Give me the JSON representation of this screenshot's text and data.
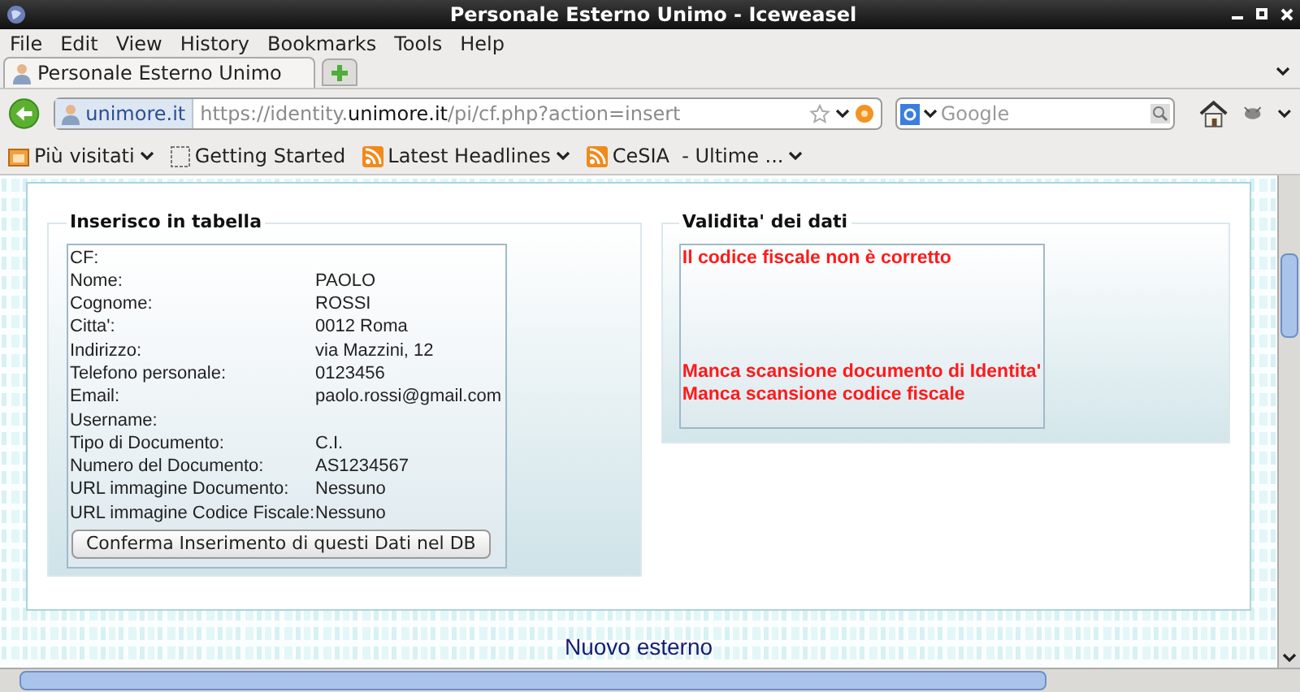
{
  "window": {
    "title": "Personale Esterno Unimo - Iceweasel"
  },
  "menu": [
    "File",
    "Edit",
    "View",
    "History",
    "Bookmarks",
    "Tools",
    "Help"
  ],
  "tabs": [
    {
      "label": "Personale Esterno Unimo",
      "selected": true
    }
  ],
  "address": {
    "site": "unimore.it",
    "url": "https://identity.**unimore.it**/pi/cf.php?action=insert"
  },
  "search": {
    "placeholder": "Google"
  },
  "bookmarks": [
    {
      "kind": "folder",
      "label": "Più visitati"
    },
    {
      "kind": "page",
      "label": "Getting Started"
    },
    {
      "kind": "feed",
      "label": "Latest Headlines"
    },
    {
      "kind": "feed",
      "label": "CeSIA  - Ultime ..."
    }
  ],
  "insert_panel": {
    "legend": "Inserisco in tabella",
    "rows": [
      {
        "label": "CF:",
        "value": ""
      },
      {
        "label": "Nome:",
        "value": "PAOLO"
      },
      {
        "label": "Cognome:",
        "value": "ROSSI"
      },
      {
        "label": "Citta':",
        "value": "0012 Roma"
      },
      {
        "label": "Indirizzo:",
        "value": "via Mazzini, 12"
      },
      {
        "label": "Telefono personale:",
        "value": "0123456"
      },
      {
        "label": "Email:",
        "value": "paolo.rossi@gmail.com"
      },
      {
        "label": "Username:",
        "value": ""
      },
      {
        "label": "Tipo di Documento:",
        "value": "C.I."
      },
      {
        "label": "Numero del Documento:",
        "value": "AS1234567"
      },
      {
        "label": "URL immagine Documento:",
        "value": "Nessuno"
      },
      {
        "label": "URL immagine Codice Fiscale:",
        "value": "Nessuno"
      }
    ],
    "button": "Conferma Inserimento di questi Dati nel DB"
  },
  "validity_panel": {
    "legend": "Validita' dei dati",
    "message_groups": [
      [
        "Il codice fiscale non è corretto"
      ],
      [
        "Manca scansione documento di Identita'",
        "Manca scansione codice fiscale"
      ]
    ]
  },
  "footer_link": "Nuovo esterno"
}
